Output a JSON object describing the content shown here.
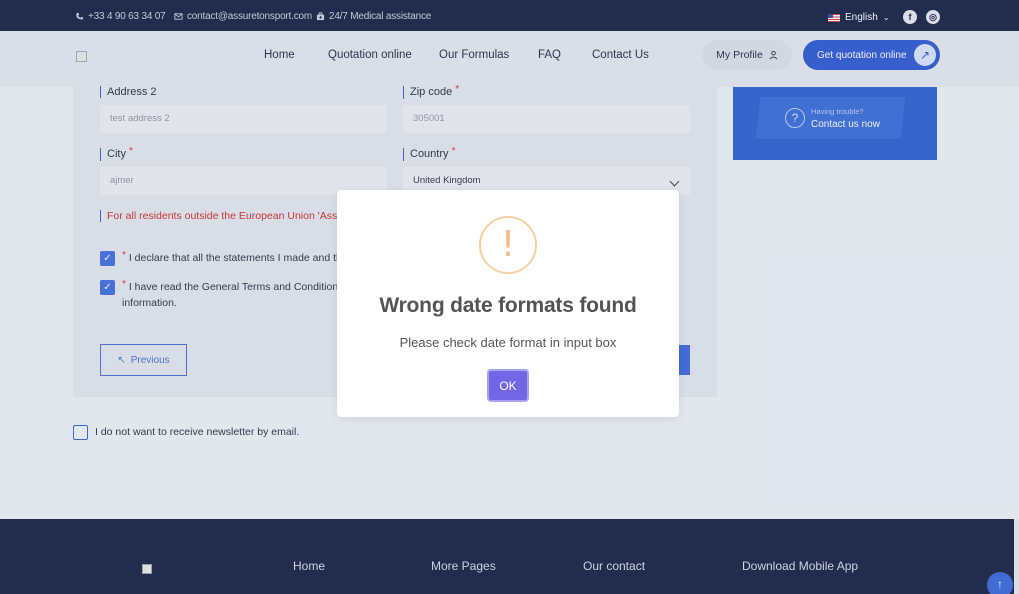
{
  "topbar": {
    "phone": "+33 4 90 63 34 07",
    "email": "contact@assuretonsport.com",
    "medical": "24/7 Medical assistance",
    "language": "English",
    "social_icons": [
      "facebook-icon",
      "instagram-icon"
    ]
  },
  "nav": {
    "links": [
      "Home",
      "Quotation online",
      "Our Formulas",
      "FAQ",
      "Contact Us"
    ],
    "profile": "My Profile",
    "quote": "Get quotation online"
  },
  "form": {
    "address2_label": "Address 2",
    "address2_value": "test address 2",
    "zip_label": "Zip code",
    "zip_value": "305001",
    "city_label": "City",
    "city_value": "ajmer",
    "country_label": "Country",
    "country_value": "United Kingdom",
    "warning": "For all residents outside the European Union 'Assu",
    "declare_text": "I declare that all the statements I made and tha",
    "terms_text_line1": "I have read the General Terms and Conditions",
    "terms_text_line2": "information.",
    "previous_label": "Previous",
    "newsletter_label": "I do not want to receive newsletter by email."
  },
  "sidebar": {
    "trouble": "Having trouble?",
    "contact": "Contact us now"
  },
  "footer": {
    "home": "Home",
    "more_pages": "More Pages",
    "our_contact": "Our contact",
    "download": "Download Mobile App"
  },
  "modal": {
    "title": "Wrong date formats found",
    "text": "Please check date format in input box",
    "ok": "OK"
  },
  "colors": {
    "navy": "#071235",
    "primary": "#1f4fd1",
    "error": "#d21a1a",
    "ok_button": "#7266e4",
    "warning_ring": "#f6cfa3"
  }
}
